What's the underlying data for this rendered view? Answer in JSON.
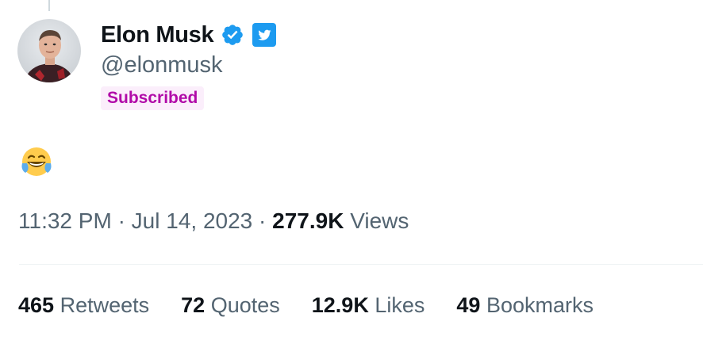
{
  "author": {
    "display_name": "Elon Musk",
    "handle": "@elonmusk",
    "subscribed_label": "Subscribed",
    "verified_icon": "verified-badge-icon",
    "affiliate_icon": "twitter-bird-icon"
  },
  "tweet": {
    "content_emoji": "face-with-tears-of-joy-icon"
  },
  "meta": {
    "time": "11:32 PM",
    "separator": "·",
    "date": "Jul 14, 2023",
    "views_count": "277.9K",
    "views_label": "Views"
  },
  "stats": [
    {
      "count": "465",
      "label": "Retweets"
    },
    {
      "count": "72",
      "label": "Quotes"
    },
    {
      "count": "12.9K",
      "label": "Likes"
    },
    {
      "count": "49",
      "label": "Bookmarks"
    }
  ],
  "colors": {
    "verified": "#1d9bf0",
    "subscribed_text": "#b10aa8",
    "subscribed_bg": "#fbeefb",
    "secondary_text": "#536471"
  }
}
